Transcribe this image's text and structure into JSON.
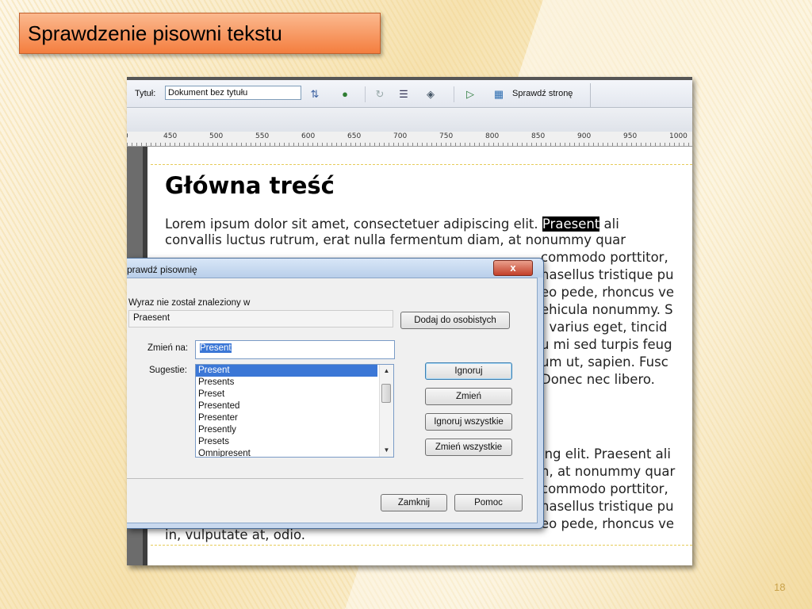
{
  "slide": {
    "title": "Sprawdzenie pisowni tekstu",
    "page_number": "18"
  },
  "toolbar": {
    "title_label": "Tytuł:",
    "title_value": "Dokument bez tytułu",
    "check_page_label": "Sprawdź stronę",
    "icons": [
      "file-management-icon",
      "preview-globe-icon",
      "refresh-icon",
      "view-options-icon",
      "visual-aids-icon",
      "validate-icon",
      "check-page-icon"
    ]
  },
  "ruler": {
    "ticks": [
      "0",
      "450",
      "500",
      "550",
      "600",
      "650",
      "700",
      "750",
      "800",
      "850",
      "900",
      "950",
      "1000"
    ]
  },
  "document": {
    "heading": "Główna treść",
    "lines": [
      {
        "before": "Lorem ipsum dolor sit amet, consectetuer adipiscing elit. ",
        "highlight": "Praesent",
        "after": " ali"
      },
      {
        "text": "convallis luctus rutrum, erat nulla fermentum diam, at nonummy quar"
      },
      {
        "text": "commodo porttitor,"
      },
      {
        "text": "hasellus tristique pu"
      },
      {
        "text": "eo pede, rhoncus ve"
      },
      {
        "text": "ehicula nonummy. S"
      },
      {
        "text": ", varius eget, tincid"
      },
      {
        "text": "u mi sed turpis feug"
      },
      {
        "text": "um ut, sapien. Fusc"
      },
      {
        "text": "Donec nec libero."
      },
      {
        "text": "ing elit. Praesent ali"
      },
      {
        "text": "n, at nonummy quar"
      },
      {
        "text": "commodo porttitor,"
      },
      {
        "text": "hasellus tristique pu"
      },
      {
        "text": "eo pede, rhoncus ve"
      },
      {
        "text": "in, vulputate at, odio."
      }
    ]
  },
  "dialog": {
    "title": "prawdź pisownię",
    "close": "x",
    "not_found_label": "Wyraz nie został znaleziony w",
    "not_found_word": "Praesent",
    "add_personal": "Dodaj do osobistych",
    "change_to_label": "Zmień na:",
    "change_to_value": "Present",
    "suggestions_label": "Sugestie:",
    "suggestions": [
      "Present",
      "Presents",
      "Preset",
      "Presented",
      "Presenter",
      "Presently",
      "Presets",
      "Omnipresent"
    ],
    "selected_suggestion": "Present",
    "ignore": "Ignoruj",
    "change": "Zmień",
    "ignore_all": "Ignoruj wszystkie",
    "change_all": "Zmień wszystkie",
    "close_button": "Zamknij",
    "help": "Pomoc"
  }
}
